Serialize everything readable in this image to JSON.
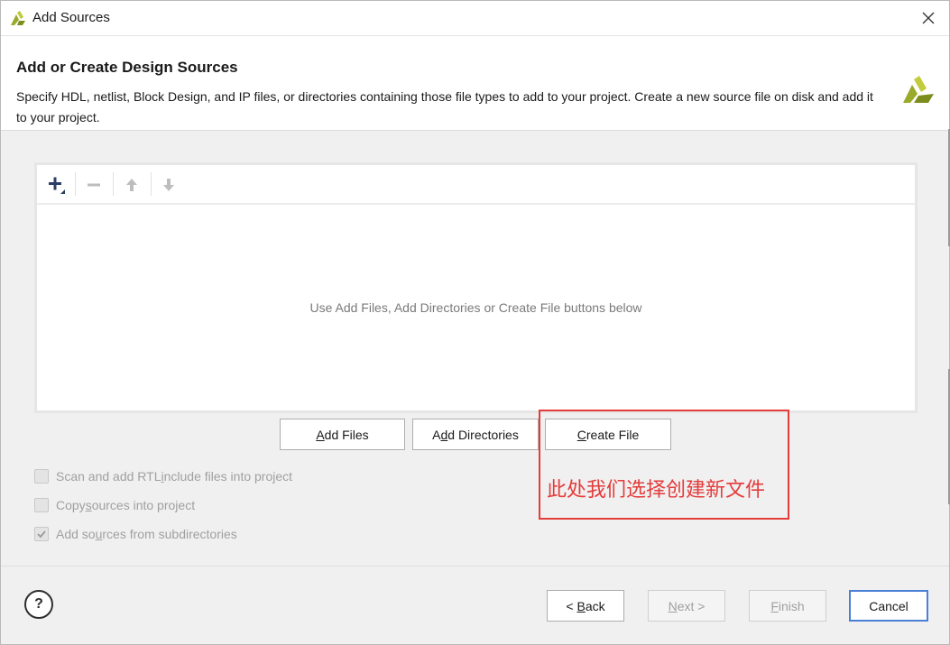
{
  "window": {
    "title": "Add Sources",
    "close_icon": "close-icon",
    "app_icon": "xilinx-logo-icon"
  },
  "header": {
    "title": "Add or Create Design Sources",
    "description": "Specify HDL, netlist, Block Design, and IP files, or directories containing those file types to add to your project. Create a new source file on disk and add it to your project.",
    "logo_icon": "xilinx-logo-icon"
  },
  "toolbar": {
    "items": [
      {
        "icon": "plus-icon",
        "enabled": true
      },
      {
        "icon": "minus-icon",
        "enabled": false
      },
      {
        "icon": "arrow-up-icon",
        "enabled": false
      },
      {
        "icon": "arrow-down-icon",
        "enabled": false
      }
    ]
  },
  "file_list": {
    "empty_hint": "Use Add Files, Add Directories or Create File buttons below"
  },
  "actions": {
    "add_files": {
      "mnemonic": "A",
      "rest": "dd Files"
    },
    "add_directories": {
      "pre": "A",
      "mnemonic": "d",
      "rest": "d Directories"
    },
    "create_file": {
      "mnemonic": "C",
      "rest": "reate File"
    }
  },
  "options": [
    {
      "pre": "Scan and add RTL ",
      "mnemonic": "i",
      "rest": "nclude files into project",
      "checked": false,
      "enabled": false
    },
    {
      "pre": "Copy ",
      "mnemonic": "s",
      "rest": "ources into project",
      "checked": false,
      "enabled": false
    },
    {
      "pre": "Add so",
      "mnemonic": "u",
      "rest": "rces from subdirectories",
      "checked": true,
      "enabled": false
    }
  ],
  "annotation": {
    "text": "此处我们选择创建新文件",
    "color": "#e53b3b"
  },
  "footer": {
    "help_label": "?",
    "back": {
      "pre": "< ",
      "mnemonic": "B",
      "rest": "ack"
    },
    "next": {
      "mnemonic": "N",
      "rest": "ext >"
    },
    "finish": {
      "mnemonic": "F",
      "rest": "inish"
    },
    "cancel": "Cancel"
  },
  "colors": {
    "accent": "#4a7fd6",
    "logo_green": "#9aaa2a",
    "annotation_red": "#e53b3b"
  }
}
